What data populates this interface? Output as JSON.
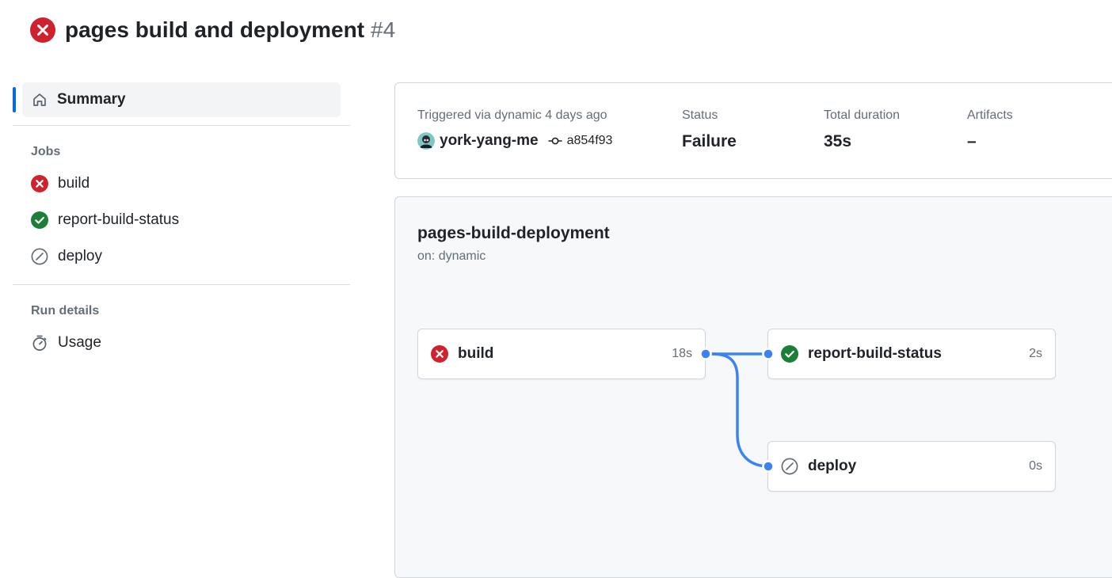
{
  "header": {
    "title": "pages build and deployment",
    "run_number": "#4",
    "status_icon": "x-circle-fill-icon"
  },
  "sidebar": {
    "summary_label": "Summary",
    "jobs_heading": "Jobs",
    "jobs": [
      {
        "label": "build",
        "status": "failure"
      },
      {
        "label": "report-build-status",
        "status": "success"
      },
      {
        "label": "deploy",
        "status": "skipped"
      }
    ],
    "run_details_heading": "Run details",
    "usage_label": "Usage"
  },
  "summary": {
    "trigger_text": "Triggered via dynamic 4 days ago",
    "actor": "york-yang-me",
    "commit_sha": "a854f93",
    "status_label": "Status",
    "status_value": "Failure",
    "duration_label": "Total duration",
    "duration_value": "35s",
    "artifacts_label": "Artifacts",
    "artifacts_value": "–"
  },
  "workflow": {
    "name": "pages-build-deployment",
    "trigger": "on: dynamic",
    "jobs": [
      {
        "name": "build",
        "duration": "18s",
        "status": "failure"
      },
      {
        "name": "report-build-status",
        "duration": "2s",
        "status": "success"
      },
      {
        "name": "deploy",
        "duration": "0s",
        "status": "skipped"
      }
    ]
  },
  "colors": {
    "failure": "#cf222e",
    "success": "#1a7f37",
    "skipped": "#656d76",
    "accent": "#0969da",
    "connector": "#3b82f6"
  }
}
